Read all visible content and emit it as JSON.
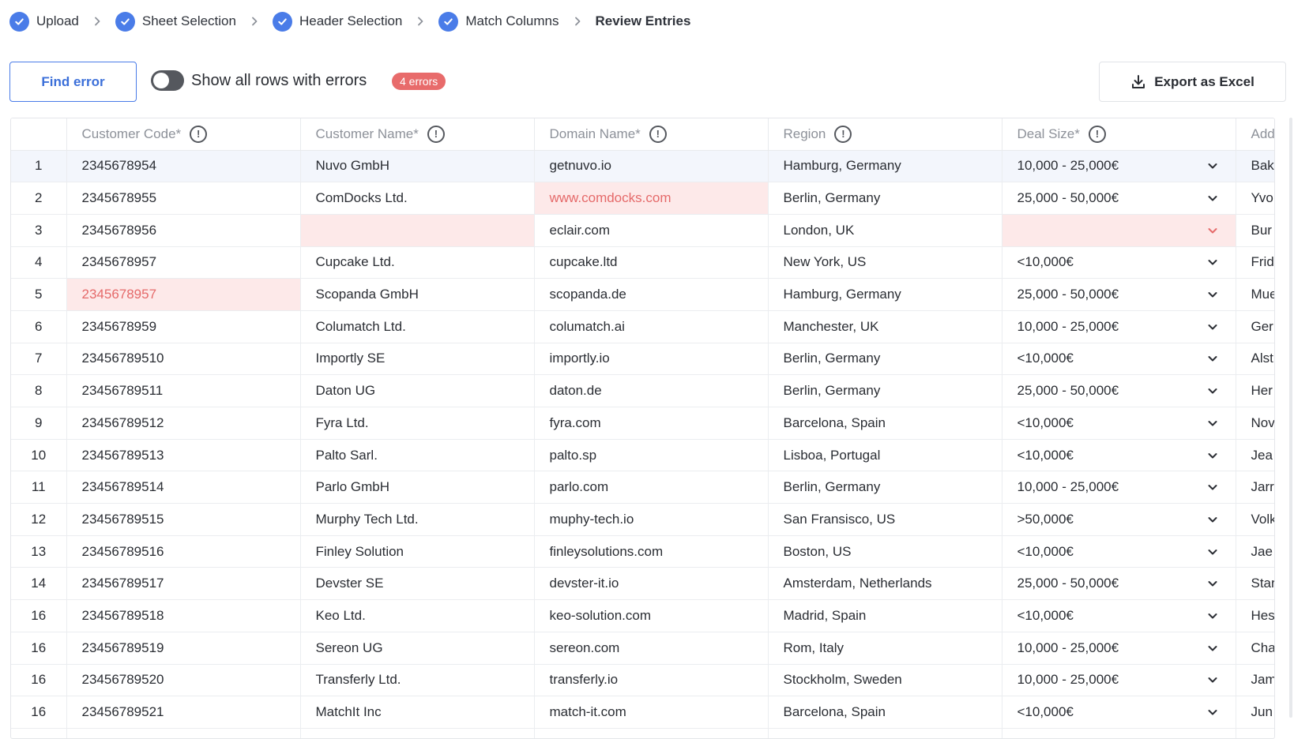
{
  "stepper": {
    "steps": [
      {
        "label": "Upload",
        "done": true
      },
      {
        "label": "Sheet Selection",
        "done": true
      },
      {
        "label": "Header Selection",
        "done": true
      },
      {
        "label": "Match Columns",
        "done": true
      },
      {
        "label": "Review Entries",
        "done": false,
        "current": true
      }
    ]
  },
  "toolbar": {
    "find_error_label": "Find error",
    "toggle_label": "Show all rows with errors",
    "toggle_on": false,
    "error_badge": "4 errors",
    "export_label": "Export as Excel"
  },
  "colors": {
    "accent": "#4a7ce8",
    "error_bg": "#fde9e9",
    "error_text": "#e56a6a",
    "badge": "#e86b6b",
    "selected_row": "#f3f6fc"
  },
  "table": {
    "columns": [
      {
        "label": "",
        "info": false
      },
      {
        "label": "Customer Code*",
        "info": true
      },
      {
        "label": "Customer Name*",
        "info": true
      },
      {
        "label": "Domain Name*",
        "info": true
      },
      {
        "label": "Region",
        "info": true
      },
      {
        "label": "Deal Size*",
        "info": true
      },
      {
        "label": "Add",
        "info": false
      }
    ],
    "rows": [
      {
        "idx": "1",
        "code": "2345678954",
        "name": "Nuvo GmbH",
        "domain": "getnuvo.io",
        "region": "Hamburg, Germany",
        "deal": "10,000 - 25,000€",
        "extra": "Bak",
        "selected": true
      },
      {
        "idx": "2",
        "code": "2345678955",
        "name": "ComDocks Ltd.",
        "domain": "www.comdocks.com",
        "region": "Berlin, Germany",
        "deal": "25,000 - 50,000€",
        "extra": "Yvo",
        "errors": [
          "domain"
        ]
      },
      {
        "idx": "3",
        "code": "2345678956",
        "name": "",
        "domain": "eclair.com",
        "region": "London, UK",
        "deal": "",
        "extra": "Bur",
        "errors": [
          "name",
          "deal"
        ]
      },
      {
        "idx": "4",
        "code": "2345678957",
        "name": "Cupcake Ltd.",
        "domain": "cupcake.ltd",
        "region": "New York, US",
        "deal": "<10,000€",
        "extra": "Frid"
      },
      {
        "idx": "5",
        "code": "2345678957",
        "name": "Scopanda GmbH",
        "domain": "scopanda.de",
        "region": "Hamburg, Germany",
        "deal": "25,000 - 50,000€",
        "extra": "Mue",
        "errors": [
          "code"
        ]
      },
      {
        "idx": "6",
        "code": "2345678959",
        "name": "Columatch Ltd.",
        "domain": "columatch.ai",
        "region": "Manchester, UK",
        "deal": "10,000 - 25,000€",
        "extra": "Ger"
      },
      {
        "idx": "7",
        "code": "23456789510",
        "name": "Importly SE",
        "domain": "importly.io",
        "region": "Berlin, Germany",
        "deal": "<10,000€",
        "extra": "Alst"
      },
      {
        "idx": "8",
        "code": "23456789511",
        "name": "Daton UG",
        "domain": "daton.de",
        "region": "Berlin, Germany",
        "deal": "25,000 - 50,000€",
        "extra": "Her"
      },
      {
        "idx": "9",
        "code": "23456789512",
        "name": "Fyra Ltd.",
        "domain": "fyra.com",
        "region": "Barcelona, Spain",
        "deal": "<10,000€",
        "extra": "Nov"
      },
      {
        "idx": "10",
        "code": "23456789513",
        "name": "Palto Sarl.",
        "domain": "palto.sp",
        "region": "Lisboa, Portugal",
        "deal": "<10,000€",
        "extra": "Jea"
      },
      {
        "idx": "11",
        "code": "23456789514",
        "name": "Parlo GmbH",
        "domain": "parlo.com",
        "region": "Berlin, Germany",
        "deal": "10,000 - 25,000€",
        "extra": "Jarr"
      },
      {
        "idx": "12",
        "code": "23456789515",
        "name": "Murphy Tech Ltd.",
        "domain": "muphy-tech.io",
        "region": "San Fransisco, US",
        "deal": ">50,000€",
        "extra": "Volk"
      },
      {
        "idx": "13",
        "code": "23456789516",
        "name": "Finley Solution",
        "domain": "finleysolutions.com",
        "region": "Boston, US",
        "deal": "<10,000€",
        "extra": "Jae"
      },
      {
        "idx": "14",
        "code": "23456789517",
        "name": "Devster SE",
        "domain": "devster-it.io",
        "region": "Amsterdam, Netherlands",
        "deal": "25,000 - 50,000€",
        "extra": "Star"
      },
      {
        "idx": "16",
        "code": "23456789518",
        "name": "Keo Ltd.",
        "domain": "keo-solution.com",
        "region": "Madrid, Spain",
        "deal": "<10,000€",
        "extra": "Hes"
      },
      {
        "idx": "16",
        "code": "23456789519",
        "name": "Sereon UG",
        "domain": "sereon.com",
        "region": "Rom, Italy",
        "deal": "10,000 - 25,000€",
        "extra": "Cha"
      },
      {
        "idx": "16",
        "code": "23456789520",
        "name": "Transferly Ltd.",
        "domain": "transferly.io",
        "region": "Stockholm, Sweden",
        "deal": "10,000 - 25,000€",
        "extra": "Jam"
      },
      {
        "idx": "16",
        "code": "23456789521",
        "name": "MatchIt Inc",
        "domain": "match-it.com",
        "region": "Barcelona, Spain",
        "deal": "<10,000€",
        "extra": "Jun"
      },
      {
        "idx": "",
        "code": "",
        "name": "",
        "domain": "",
        "region": "",
        "deal": "",
        "extra": ""
      }
    ]
  }
}
